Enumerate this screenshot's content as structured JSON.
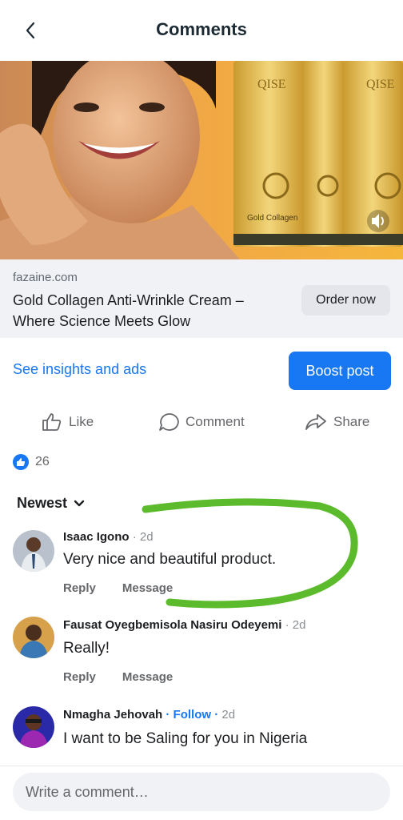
{
  "header": {
    "title": "Comments",
    "back_icon": "chevron-left-icon"
  },
  "ad": {
    "product_label_1": "QISE",
    "product_label_2": "Gold Collagen",
    "domain": "fazaine.com",
    "title": "Gold Collagen Anti-Wrinkle Cream – Where Science Meets Glow",
    "cta": "Order now"
  },
  "insights_link": "See insights and ads",
  "boost_button": "Boost post",
  "actions": {
    "like": "Like",
    "comment": "Comment",
    "share": "Share"
  },
  "reactions": {
    "count": "26",
    "icon": "like-icon"
  },
  "sort": {
    "label": "Newest"
  },
  "comments": [
    {
      "name": "Isaac Igono",
      "time": " · 2d",
      "follow": "",
      "text": "Very nice and beautiful product.",
      "reply": "Reply",
      "message": "Message"
    },
    {
      "name": "Fausat Oyegbemisola Nasiru Odeyemi",
      "time": " · 2d",
      "follow": "",
      "text": "Really!",
      "reply": "Reply",
      "message": "Message"
    },
    {
      "name": "Nmagha Jehovah",
      "time": " 2d",
      "follow": " · Follow ·",
      "text": "I want to be Saling for you in Nigeria",
      "reply": "",
      "message": ""
    }
  ],
  "composer": {
    "placeholder": "Write a comment…"
  },
  "colors": {
    "accent": "#1877f2",
    "annotation": "#5cbb2c"
  }
}
